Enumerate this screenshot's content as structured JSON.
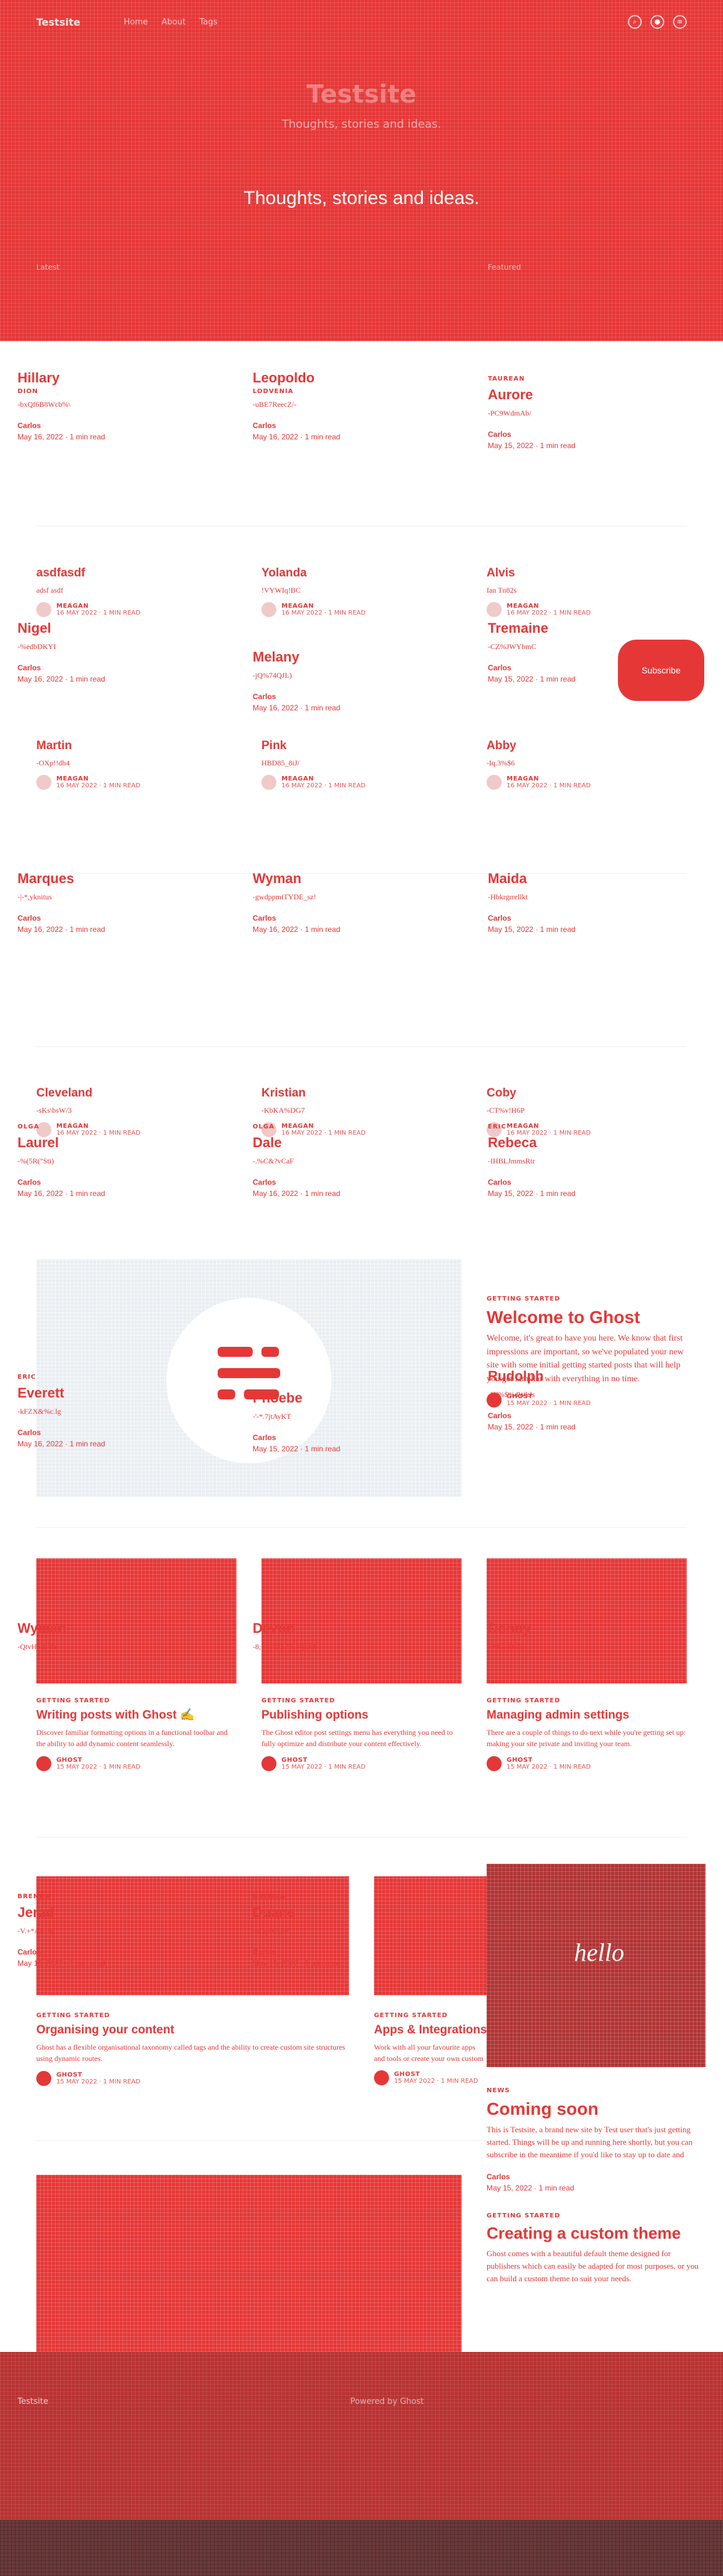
{
  "site": {
    "logo": "Testsite",
    "nav": [
      "Home",
      "About",
      "Tags"
    ],
    "title": "Testsite",
    "subtitle": "Thoughts, stories and ideas.",
    "tagline": "Thoughts, stories and ideas.",
    "hero_foot_left": "Latest",
    "hero_foot_right": "Featured"
  },
  "authors_row1": [
    {
      "name": "Hillary",
      "sub": "Dion",
      "code": "-bxQf6B8Wcb%\\",
      "author": "Carlos",
      "date": "May 16, 2022 · 1 min read"
    },
    {
      "name": "Leopoldo",
      "sub": "Lodvenia",
      "code": "-uBE7ReecZ/-",
      "author": "Carlos",
      "date": "May 16, 2022 · 1 min read"
    },
    {
      "name": "Aurore",
      "sub": "Taurean",
      "code": "-PC9WdmAb/",
      "author": "Carlos",
      "date": "May 15, 2022 · 1 min read"
    }
  ],
  "posts_row1": [
    {
      "title": "asdfasdf",
      "excerpt": "adsf asdf",
      "who": "MEAGAN",
      "when": "16 MAY 2022 · 1 MIN READ"
    },
    {
      "title": "Yolanda",
      "excerpt": "!VYWIq!BC",
      "who": "MEAGAN",
      "when": "16 MAY 2022 · 1 MIN READ"
    },
    {
      "title": "Alvis",
      "excerpt": "Ian Tn82s",
      "who": "MEAGAN",
      "when": "16 MAY 2022 · 1 MIN READ"
    }
  ],
  "authors_row2": [
    {
      "name": "Nigel",
      "code": "-%edbDKYI",
      "author": "Carlos",
      "date": "May 16, 2022 · 1 min read"
    },
    {
      "name": "Melany",
      "code": "-jQ%74QJL)",
      "author": "Carlos",
      "date": "May 16, 2022 · 1 min read"
    },
    {
      "name": "Tremaine",
      "code": "-CZ%JWYbmC",
      "author": "Carlos",
      "date": "May 15, 2022 · 1 min read"
    }
  ],
  "posts_row2": [
    {
      "title": "Martin",
      "excerpt": "-OXp!!dh4",
      "who": "MEAGAN",
      "when": "16 MAY 2022 · 1 MIN READ"
    },
    {
      "title": "Pink",
      "excerpt": "HBD85_8iJ/",
      "who": "MEAGAN",
      "when": "16 MAY 2022 · 1 MIN READ"
    },
    {
      "title": "Abby",
      "excerpt": "-Iq.3%$6",
      "who": "MEAGAN",
      "when": "16 MAY 2022 · 1 MIN READ"
    }
  ],
  "authors_row3": [
    {
      "name": "Marques",
      "code": "-|-*,yknitus",
      "author": "Carlos",
      "date": "May 16, 2022 · 1 min read"
    },
    {
      "name": "Wyman",
      "code": "-gwdppmtTYDE_sz!",
      "author": "Carlos",
      "date": "May 16, 2022 · 1 min read"
    },
    {
      "name": "Maida",
      "code": "-Hbkrgrrellkt",
      "author": "Carlos",
      "date": "May 15, 2022 · 1 min read"
    }
  ],
  "posts_row3": [
    {
      "title": "Cleveland",
      "excerpt": "-sKs\\bsW/3",
      "who": "MEAGAN",
      "when": "16 MAY 2022 · 1 MIN READ"
    },
    {
      "title": "Kristian",
      "excerpt": "-KbKA%DG7",
      "who": "MEAGAN",
      "when": "16 MAY 2022 · 1 MIN READ"
    },
    {
      "title": "Coby",
      "excerpt": "-CT%v!H6P",
      "who": "MEAGAN",
      "when": "16 MAY 2022 · 1 MIN READ"
    }
  ],
  "authors_row4": [
    {
      "name": "Laurel",
      "tag": "OLGA",
      "code": "-%(5R(\"Sti)",
      "author": "Carlos",
      "date": "May 16, 2022 · 1 min read"
    },
    {
      "name": "Dale",
      "tag": "OLGA",
      "code": "-.%C&?vCaF",
      "author": "Carlos",
      "date": "May 16, 2022 · 1 min read"
    },
    {
      "name": "Rebeca",
      "tag": "ERIC",
      "code": "-IHBLJmmsRtr",
      "author": "Carlos",
      "date": "May 15, 2022 · 1 min read"
    }
  ],
  "welcome": {
    "tag": "GETTING STARTED",
    "title": "Welcome to Ghost",
    "excerpt": "Welcome, it's great to have you here. We know that first impressions are important, so we've populated your new site with some initial getting started posts that will help you get familiar with everything in no time.",
    "who": "GHOST",
    "when": "15 MAY 2022 · 1 MIN READ"
  },
  "authors_row5": [
    {
      "name": "Everett",
      "tag": "ERIC",
      "code": "-kFZX&%c.lg",
      "author": "Carlos",
      "date": "May 16, 2022 · 1 min read"
    },
    {
      "name": "Phoebe",
      "code": "-'-*.7jtAyKT",
      "author": "Carlos",
      "date": "May 15, 2022 · 1 min read"
    },
    {
      "name": "Rudolph",
      "code": "-U]%$%dWkJs",
      "author": "Carlos",
      "date": "May 15, 2022 · 1 min read"
    }
  ],
  "authors_row6": [
    {
      "name": "Wyman",
      "code": "-QtvHbRRth"
    },
    {
      "name": "Devon",
      "code": "-8;+7yRQ.Z&MjxNb"
    },
    {
      "name": "Donny",
      "code": "-Wty;cD5Sy"
    }
  ],
  "ghost_row1": [
    {
      "tag": "GETTING STARTED",
      "title": "Writing posts with Ghost ✍️",
      "excerpt": "Discover familiar formatting options in a functional toolbar and the ability to add dynamic content seamlessly.",
      "who": "GHOST",
      "when": "15 MAY 2022 · 1 MIN READ"
    },
    {
      "tag": "GETTING STARTED",
      "title": "Publishing options",
      "excerpt": "The Ghost editor post settings menu has everything you need to fully optimize and distribute your content effectively.",
      "who": "GHOST",
      "when": "15 MAY 2022 · 1 MIN READ"
    },
    {
      "tag": "GETTING STARTED",
      "title": "Managing admin settings",
      "excerpt": "There are a couple of things to do next while you're getting set up: making your site private and inviting your team.",
      "who": "GHOST",
      "when": "15 MAY 2022 · 1 MIN READ"
    }
  ],
  "authors_row7": [
    {
      "name": "Jerad",
      "tag": "BRENDA",
      "code": "-V.+*AP1ep",
      "author": "Carlos",
      "date": "May 16, 2022 · 1 min read"
    },
    {
      "name": "Duane",
      "tag": "BRENDA",
      "code": "-oUgs+Y6P",
      "author": "Carlos",
      "date": "May 16, 2022 · 1 min read"
    }
  ],
  "ghost_row2": [
    {
      "tag": "GETTING STARTED",
      "title": "Organising your content",
      "excerpt": "Ghost has a flexible organisational taxonomy called tags and the ability to create custom site structures using dynamic routes.",
      "who": "GHOST",
      "when": "15 MAY 2022 · 1 MIN READ"
    },
    {
      "tag": "GETTING STARTED",
      "title": "Apps & Integrations",
      "excerpt": "Work with all your favourite apps and tools or create your own custom integrations using the Ghost API.",
      "who": "GHOST",
      "when": "15 MAY 2022 · 1 MIN READ"
    }
  ],
  "hello_image_text": "hello",
  "coming_soon": {
    "tag": "NEWS",
    "title": "Coming soon",
    "excerpt": "This is Testsite, a brand new site by Test user that's just getting started. Things will be up and running here shortly, but you can subscribe in the meantime if you'd like to stay up to date and receive emails when new content is published!",
    "author": "Carlos",
    "date": "May 15, 2022 · 1 min read"
  },
  "custom_theme": {
    "tag": "GETTING STARTED",
    "title": "Creating a custom theme",
    "excerpt": "Ghost comes with a beautiful default theme designed for publishers which can easily be adapted for most purposes, or you can build a custom theme to suit your needs."
  },
  "subscribe_label": "Subscribe",
  "footer": {
    "left": "Testsite",
    "right": "Powered by Ghost"
  }
}
